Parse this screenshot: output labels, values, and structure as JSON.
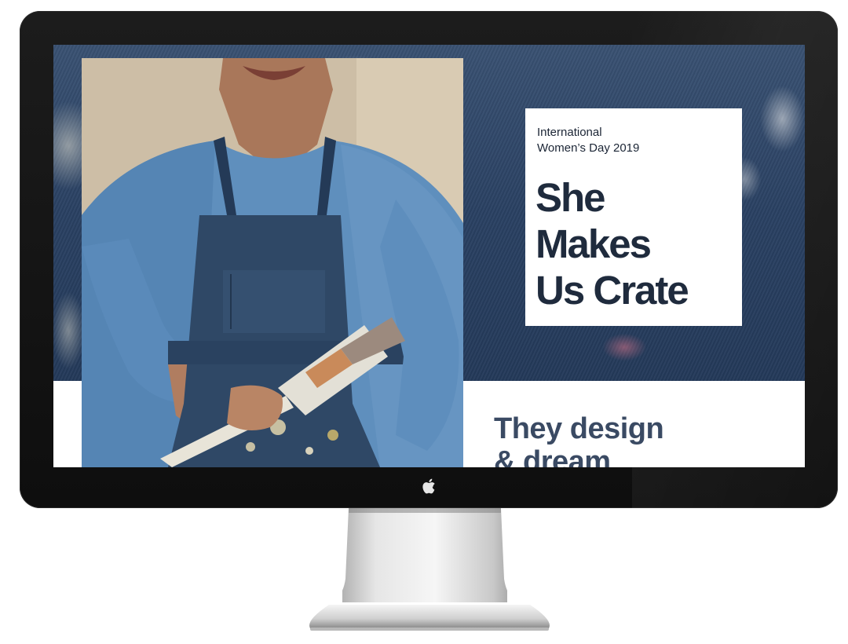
{
  "campaign": {
    "eyebrow_line1": "International",
    "eyebrow_line2": "Women’s Day 2019",
    "headline_line1": "She",
    "headline_line2": "Makes",
    "headline_line3": "Us Crate"
  },
  "section": {
    "subhead_line1": "They design",
    "subhead_line2": "& dream"
  },
  "colors": {
    "text_dark": "#1f2b3d",
    "subhead": "#3a4a63",
    "denim": "#2a4163",
    "bezel": "#111111"
  },
  "icons": {
    "device_logo": "apple-logo-icon"
  }
}
